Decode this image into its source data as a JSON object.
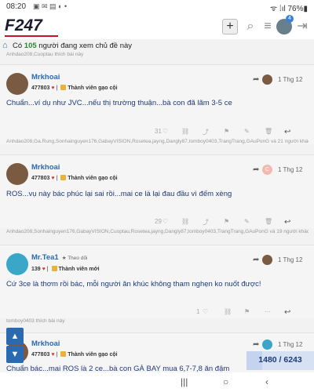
{
  "status": {
    "time": "08:20",
    "icons": "▣ ✉ ▤ ◐ •",
    "right": "ᯤ ⁞ıl 76%▮"
  },
  "header": {
    "logo": "F247",
    "plus": "+",
    "search_icon": "⌕",
    "menu_icon": "≡",
    "badge": "4",
    "logout_icon": "⇥"
  },
  "viewers": {
    "prefix": "Có",
    "count": "105",
    "suffix": "người đang xem chủ đề này"
  },
  "top_likers": "Anhdao208,Cuoptau thích bài này",
  "posts": [
    {
      "name": "Mrkhoai",
      "points": "477803",
      "rank": "Thành viên gạo cội",
      "date": "1 Thg 12",
      "text": "Chuẩn...ví dụ như JVC...nếu thị trường thuận...bà con đã lãm 3-5 ce",
      "likes": "31",
      "likers": "Anhdao208,Ga.Rung,Sonhainguyen176,GabayVISION,Rosetea,jayng,Dangly87,tomboy0403,TrangTrang,GAuPonG và 21 người khác thích bài này"
    },
    {
      "name": "Mrkhoai",
      "points": "477803",
      "rank": "Thành viên gạo cội",
      "date": "1 Thg 12",
      "reply_avatar": "C",
      "text": "ROS...vụ này bác phúc lại sai rồi...mai ce là lại đau đầu vì đếm xèng",
      "likes": "29",
      "likers": "Anhdao208,Sonhainguyen176,GabayVISION,Cuoptau,Rosetea,jayng,Dangly87,tomboy0403,TrangTrang,GAuPonG và 19 người khác thích bài này"
    },
    {
      "name": "Mr.Tea1",
      "follow": "Theo dõi",
      "points": "139",
      "rank": "Thành viên mới",
      "date": "1 Thg 12",
      "text": "Cứ 3ce là thơm rồi bác, mỗi người ăn khúc không tham nghẹn ko nuốt được!",
      "likes": "1",
      "likers": "tomboy0403 thích bài này"
    },
    {
      "name": "Mrkhoai",
      "points": "477803",
      "rank": "Thành viên gạo cội",
      "date": "1 Thg 12",
      "text": "Chuẩn bác...mai ROS là 2 ce...bà con GÀ BAY mua 6,7-7,8 ăn đậm"
    }
  ],
  "action_icons": {
    "link": "⛓",
    "share": "⤴",
    "bookmark": "⚑",
    "edit": "✎",
    "more": "⋯",
    "delete": "🗑",
    "reply": "↩",
    "heart": "♡"
  },
  "progress": {
    "text": "1480 / 6243",
    "fraction": 0.237
  },
  "nav": {
    "recent": "|||",
    "home": "○",
    "back": "‹"
  },
  "colors": {
    "accent": "#2a6ab0",
    "brand_red": "#d0102a",
    "online": "#2a8a2a"
  }
}
